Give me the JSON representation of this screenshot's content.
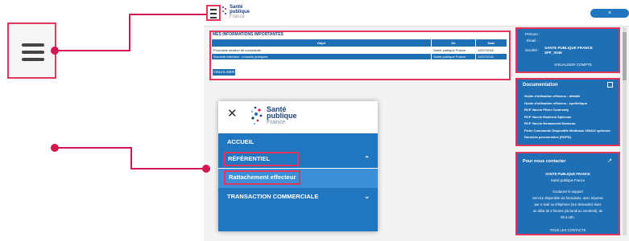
{
  "callout": {
    "burger_icon": "hamburger-menu-icon",
    "accent_color": "#d3164f"
  },
  "topbar": {
    "logo_line1": "Santé",
    "logo_line2": "publique",
    "logo_line3": "France",
    "right_button_label": "×"
  },
  "info_panel": {
    "title": "MES INFORMATIONS IMPORTANTES",
    "headers": [
      "Objet",
      "De",
      "Date"
    ],
    "rows": [
      [
        "Prochaine session de commande",
        "Santé publique France",
        "12/07/2022"
      ],
      [
        "Nouvelle interface : conseils pratiques",
        "Santé publique France",
        "12/07/2022"
      ]
    ],
    "button_label": "VISUALISER"
  },
  "profile_panel": {
    "prenom_label": "Prénom :",
    "email_label": "Email :",
    "societe_label": "Société :",
    "societe_value_line1": "SANTE PUBLIQUE FRANCE",
    "societe_value_line2": "SPF_X046",
    "link": "VISUALISER COMPTE"
  },
  "documentation_panel": {
    "title": "Documentation",
    "items": [
      "Guide d'utilisation efficiens : détaillé",
      "Guide d'utilisation efficiens : synthétique",
      "RCP Vaccin Pfizer Comirnaty",
      "RCP Vaccin Moderna Spikevax",
      "RCP Vaccin Novavaxvid Nuvaxoa",
      "Fiche Commande Dispositifs Médicaux 290422 spikevax",
      "Données personnelles (RGPD)"
    ]
  },
  "contact_panel": {
    "title": "Pour nous contacter",
    "org_line1": "SANTE PUBLIQUE FRANCE",
    "org_line2": "Santé publique France",
    "support_title": "Contacter le support",
    "support_text1": "Service disponible via formulaire, avec réponse",
    "support_text2": "par e-mail ou téléphone (sur demande) dans",
    "support_text3": "un délai de 2 heures (du lundi au vendredi), de",
    "support_text4": "9h à 19h.",
    "all_contacts": "TOUS LES CONTACTS"
  },
  "menu": {
    "close_glyph": "✕",
    "logo_line1": "Santé",
    "logo_line2": "publique",
    "logo_line3": "France",
    "items": {
      "accueil": "ACCUEIL",
      "referentiel": "RÉFÉRENTIEL",
      "rattachement": "Rattachement effecteur",
      "transaction": "TRANSACTION COMMERCIALE"
    },
    "chevron_up": "⌃",
    "chevron_down": "⌄"
  }
}
